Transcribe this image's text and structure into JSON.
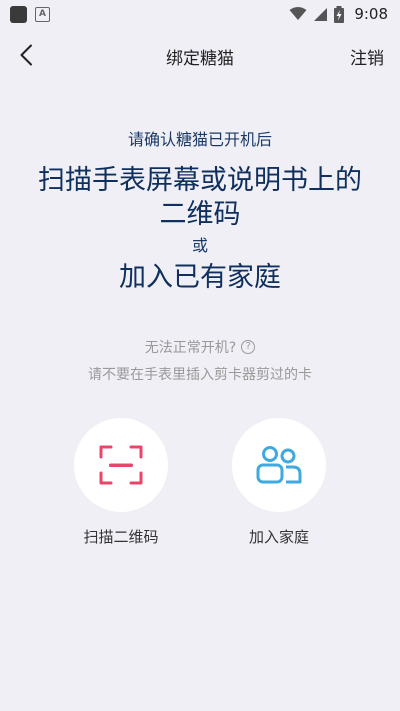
{
  "status_bar": {
    "time": "9:08",
    "icons": [
      "app-square-icon",
      "a-notification-icon",
      "wifi-icon",
      "signal-icon",
      "battery-charging-icon"
    ]
  },
  "header": {
    "title": "绑定糖猫",
    "back_icon": "chevron-left-icon",
    "action_label": "注销"
  },
  "instruction": {
    "subtitle": "请确认糖猫已开机后",
    "line1": "扫描手表屏幕或说明书上的",
    "line2": "二维码",
    "or": "或",
    "line3": "加入已有家庭"
  },
  "hints": {
    "cannot_power_on": "无法正常开机?",
    "help_icon": "question-circle-icon",
    "sim_warning": "请不要在手表里插入剪卡器剪过的卡"
  },
  "actions": {
    "scan": {
      "label": "扫描二维码",
      "icon": "scan-icon",
      "color": "#e8456a"
    },
    "join": {
      "label": "加入家庭",
      "icon": "family-icon",
      "color": "#3fa9e0"
    }
  }
}
